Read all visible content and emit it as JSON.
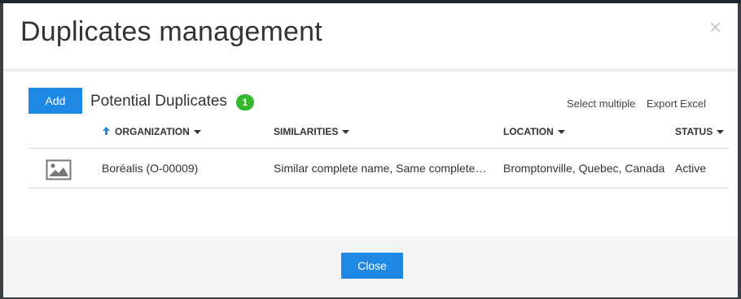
{
  "modal": {
    "title": "Duplicates management",
    "close_glyph": "×"
  },
  "toolbar": {
    "add_label": "Add",
    "section_title": "Potential Duplicates",
    "count": "1",
    "select_multiple_label": "Select multiple",
    "export_label": "Export Excel"
  },
  "table": {
    "columns": [
      {
        "label": "ORGANIZATION",
        "sorted": "ascending"
      },
      {
        "label": "SIMILARITIES"
      },
      {
        "label": "LOCATION"
      },
      {
        "label": "STATUS"
      }
    ],
    "rows": [
      {
        "thumbnail_icon": "image-placeholder-icon",
        "organization": "Boréalis (O-00009)",
        "similarities": "Similar complete name, Same complete address",
        "location": "Bromptonville, Quebec, Canada",
        "status": "Active"
      }
    ]
  },
  "footer": {
    "close_label": "Close"
  },
  "colors": {
    "primary": "#1e88e5",
    "badge": "#35b82f",
    "footer_bg": "#f4f4f4"
  }
}
